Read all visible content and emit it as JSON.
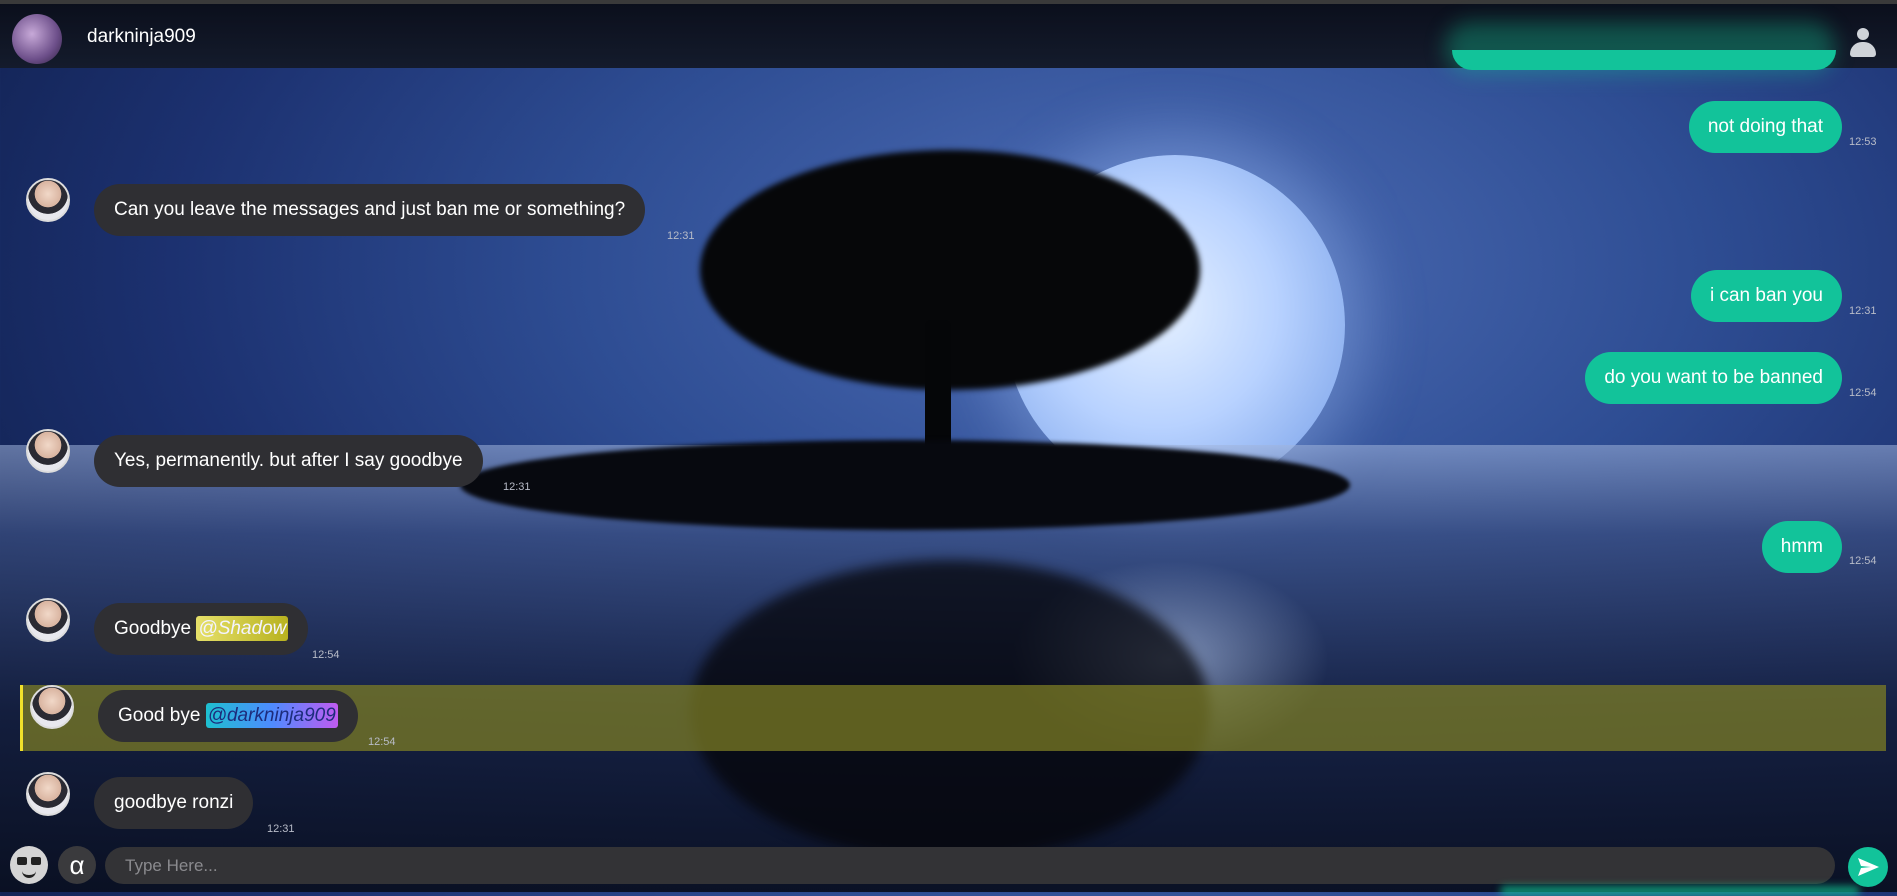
{
  "header": {
    "username": "darkninja909"
  },
  "messages": [
    {
      "id": "m1",
      "direction": "out",
      "text": "not doing that",
      "time": "12:53"
    },
    {
      "id": "m2",
      "direction": "in",
      "text": "Can you leave the messages and just ban me or something?",
      "time": "12:31"
    },
    {
      "id": "m3",
      "direction": "out",
      "text": "i can ban you",
      "time": "12:31"
    },
    {
      "id": "m4",
      "direction": "out",
      "text": "do you want to be banned",
      "time": "12:54"
    },
    {
      "id": "m5",
      "direction": "in",
      "text": "Yes, permanently. but after I say goodbye",
      "time": "12:31"
    },
    {
      "id": "m6",
      "direction": "out",
      "text": "hmm",
      "time": "12:54"
    },
    {
      "id": "m7",
      "direction": "in",
      "text": "Goodbye",
      "mention": "@Shadow",
      "time": "12:54"
    },
    {
      "id": "m8",
      "direction": "in",
      "text": "Good bye",
      "mention": "@darkninja909",
      "time": "12:54",
      "highlighted": true
    },
    {
      "id": "m9",
      "direction": "in",
      "text": "goodbye ronzi",
      "time": "12:31"
    }
  ],
  "composer": {
    "placeholder": "Type Here...",
    "alpha_label": "α"
  },
  "colors": {
    "outgoing_bubble": "#12c39a",
    "incoming_bubble": "#2f2f33",
    "highlight": "#80802a"
  }
}
